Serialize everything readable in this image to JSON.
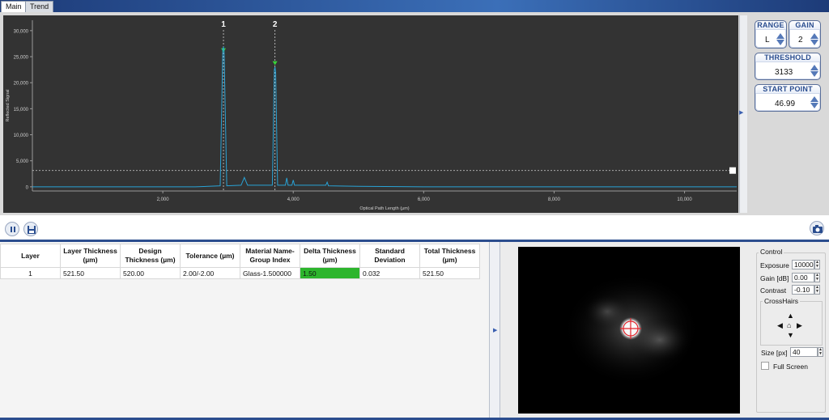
{
  "tabs": [
    {
      "label": "Main",
      "active": true
    },
    {
      "label": "Trend",
      "active": false
    }
  ],
  "chart_data": {
    "type": "line",
    "xlabel": "Optical Path Length (µm)",
    "ylabel": "Reflected Signal",
    "xlim": [
      0,
      10800
    ],
    "ylim": [
      -800,
      32000
    ],
    "x_ticks": [
      2000,
      4000,
      6000,
      8000,
      10000
    ],
    "x_tick_labels": [
      "2,000",
      "4,000",
      "6,000",
      "8,000",
      "10,000"
    ],
    "y_ticks": [
      0,
      5000,
      10000,
      15000,
      20000,
      25000,
      30000
    ],
    "y_tick_labels": [
      "0",
      "5,000",
      "10,000",
      "15,000",
      "20,000",
      "25,000",
      "30,000"
    ],
    "threshold": 3133,
    "peak_markers": [
      {
        "label": "1",
        "x": 2930,
        "y": 26000
      },
      {
        "label": "2",
        "x": 3720,
        "y": 23500
      }
    ],
    "series": [
      {
        "color": "#29a3d6",
        "x": [
          0,
          500,
          1000,
          1500,
          2000,
          2500,
          2880,
          2920,
          2930,
          2940,
          2980,
          3200,
          3250,
          3300,
          3680,
          3710,
          3720,
          3730,
          3760,
          3880,
          3900,
          3920,
          3980,
          4000,
          4020,
          4500,
          4520,
          4540,
          5000,
          6000,
          7000,
          8000,
          9000,
          10000,
          10800
        ],
        "y": [
          0,
          0,
          0,
          0,
          0,
          0,
          200,
          26500,
          26800,
          26000,
          200,
          300,
          1800,
          300,
          300,
          22500,
          23000,
          22000,
          300,
          300,
          1700,
          300,
          300,
          1300,
          300,
          300,
          900,
          200,
          100,
          0,
          0,
          0,
          0,
          0,
          0
        ]
      }
    ],
    "grid": false
  },
  "controls": {
    "range": {
      "title": "RANGE",
      "value": "L"
    },
    "gain": {
      "title": "GAIN",
      "value": "2"
    },
    "threshold": {
      "title": "THRESHOLD",
      "value": "3133"
    },
    "start_point": {
      "title": "START POINT",
      "value": "46.99"
    }
  },
  "toolbar": {
    "left_icons": [
      "pause-icon",
      "save-icon"
    ],
    "right_icons": [
      "camera-icon"
    ]
  },
  "table": {
    "headers": [
      "Layer",
      "Layer Thickness (µm)",
      "Design Thickness (µm)",
      "Tolerance (µm)",
      "Material Name-Group Index",
      "Delta Thickness (µm)",
      "Standard Deviation",
      "Total Thickness (µm)"
    ],
    "rows": [
      [
        "1",
        "521.50",
        "520.00",
        "2.00/-2.00",
        "Glass-1.500000",
        "1.50",
        "0.032",
        "521.50"
      ]
    ],
    "delta_ok_color": "#2db52d"
  },
  "camera": {
    "control_title": "Control",
    "exposure_label": "Exposure",
    "exposure_value": "10000",
    "gain_label": "Gain [dB]",
    "gain_value": "0.00",
    "contrast_label": "Contrast",
    "contrast_value": "-0.10",
    "crosshairs_label": "CrossHairs",
    "size_label": "Size [px]",
    "size_value": "40",
    "fullscreen_label": "Full Screen",
    "fullscreen_checked": false
  }
}
